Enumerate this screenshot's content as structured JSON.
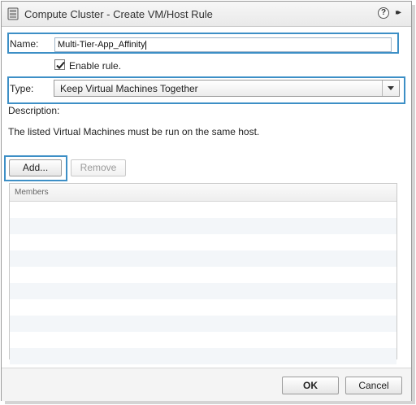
{
  "dialog": {
    "title": "Compute Cluster - Create VM/Host Rule",
    "help_glyph": "?",
    "expand_glyph": "▸▸"
  },
  "form": {
    "name_label": "Name:",
    "name_value": "Multi-Tier-App_Affinity",
    "enable_rule_label": "Enable rule.",
    "enable_rule_checked": true,
    "type_label": "Type:",
    "type_value": "Keep Virtual Machines Together",
    "description_label": "Description:",
    "description_text": "The listed Virtual Machines must be run on the same host."
  },
  "actions": {
    "add_label": "Add...",
    "remove_label": "Remove"
  },
  "members": {
    "header": "Members",
    "rows": []
  },
  "footer": {
    "ok_label": "OK",
    "cancel_label": "Cancel"
  },
  "colors": {
    "highlight": "#3d8fc6",
    "row_alt": "#f3f6f9"
  }
}
